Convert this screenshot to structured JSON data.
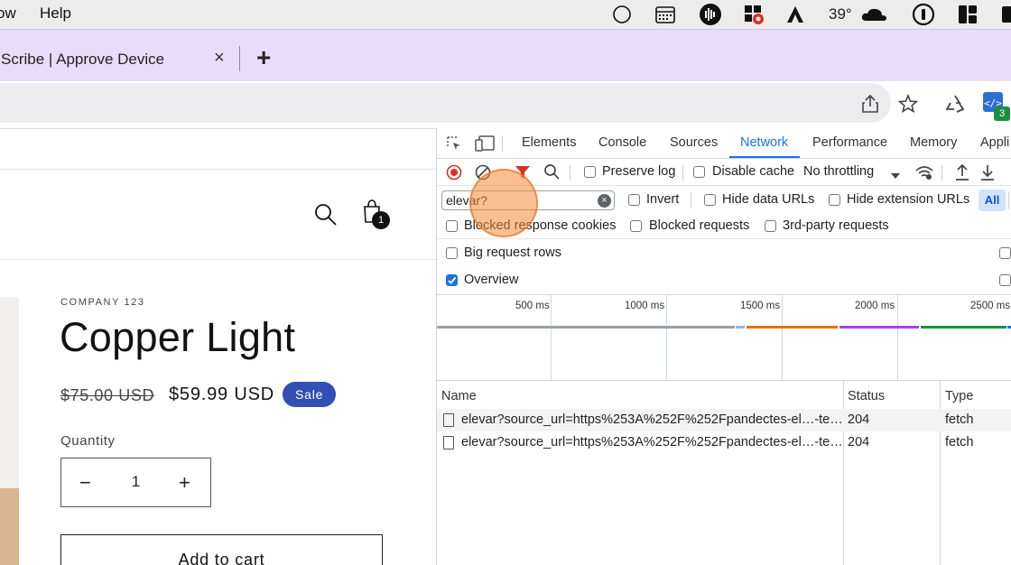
{
  "menubar": {
    "items": [
      "ow",
      "Help"
    ],
    "weather": "39°"
  },
  "tab": {
    "title": "Scribe | Approve Device",
    "close": "×",
    "new": "+"
  },
  "extensions": {
    "badge": "3"
  },
  "store": {
    "vendor": "COMPANY 123",
    "title": "Copper Light",
    "price_old": "$75.00 USD",
    "price_new": "$59.99 USD",
    "sale_badge": "Sale",
    "quantity_label": "Quantity",
    "quantity_value": "1",
    "minus": "−",
    "plus": "+",
    "add_to_cart": "Add to cart",
    "cart_count": "1"
  },
  "devtools": {
    "tabs": [
      "Elements",
      "Console",
      "Sources",
      "Network",
      "Performance",
      "Memory",
      "Appli"
    ],
    "active_tab": "Network",
    "preserve_log": "Preserve log",
    "disable_cache": "Disable cache",
    "throttling": "No throttling",
    "filter_value": "elevar?",
    "invert": "Invert",
    "hide_data_urls": "Hide data URLs",
    "hide_extension_urls": "Hide extension URLs",
    "all": "All",
    "blocked_response_cookies": "Blocked response cookies",
    "blocked_requests": "Blocked requests",
    "third_party": "3rd-party requests",
    "big_request_rows": "Big request rows",
    "overview": "Overview",
    "ticks": [
      "500 ms",
      "1000 ms",
      "1500 ms",
      "2000 ms",
      "2500 ms"
    ],
    "columns": {
      "name": "Name",
      "status": "Status",
      "type": "Type"
    },
    "rows": [
      {
        "name": "elevar?source_url=https%253A%252F%252Fpandectes-el…-te…",
        "status": "204",
        "type": "fetch"
      },
      {
        "name": "elevar?source_url=https%253A%252F%252Fpandectes-el…-te…",
        "status": "204",
        "type": "fetch"
      }
    ]
  },
  "colors": {
    "tab_strip": "#e8dcfa",
    "sale_badge": "#334fb4",
    "devtools_accent": "#1a73e8",
    "record_red": "#d93025"
  }
}
